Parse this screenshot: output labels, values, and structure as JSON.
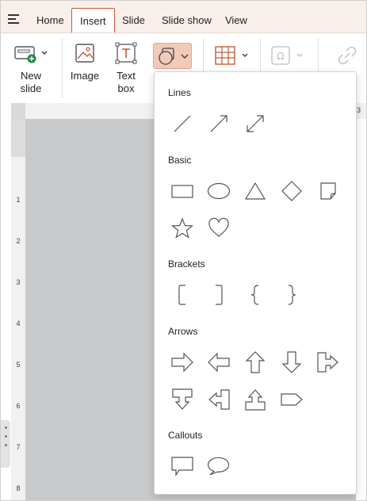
{
  "tabs": [
    {
      "label": "Home",
      "active": false
    },
    {
      "label": "Insert",
      "active": true
    },
    {
      "label": "Slide",
      "active": false
    },
    {
      "label": "Slide show",
      "active": false
    },
    {
      "label": "View",
      "active": false
    }
  ],
  "ribbon": {
    "new_slide_line1": "New",
    "new_slide_line2": "slide",
    "image": "Image",
    "text_box_line1": "Text",
    "text_box_line2": "box"
  },
  "rulers": {
    "vertical": [
      "1",
      "2",
      "3",
      "4",
      "5",
      "6",
      "7",
      "8"
    ],
    "horizontal_visible": "3"
  },
  "shapes_panel": {
    "sections": [
      {
        "title": "Lines",
        "items": [
          "line-icon",
          "arrow-line-icon",
          "double-arrow-line-icon"
        ]
      },
      {
        "title": "Basic",
        "items": [
          "rectangle-icon",
          "ellipse-icon",
          "triangle-icon",
          "diamond-icon",
          "folded-corner-icon",
          "star-icon",
          "heart-icon"
        ]
      },
      {
        "title": "Brackets",
        "items": [
          "left-bracket-icon",
          "right-bracket-icon",
          "left-brace-icon",
          "right-brace-icon"
        ]
      },
      {
        "title": "Arrows",
        "items": [
          "right-arrow-icon",
          "left-arrow-icon",
          "up-arrow-icon",
          "down-arrow-icon",
          "right-arrow-callout-icon",
          "down-arrow-callout-icon",
          "left-arrow-callout-icon",
          "up-arrow-callout-icon",
          "pentagon-arrow-icon"
        ]
      },
      {
        "title": "Callouts",
        "items": [
          "rectangular-callout-icon",
          "oval-callout-icon"
        ]
      }
    ]
  },
  "colors": {
    "tab_bar_bg": "#f8efea",
    "accent": "#c55a3a",
    "selected_button_bg": "#f3c9b9",
    "canvas_bg": "#c8c9cb",
    "new_slide_badge": "#1f8a4c",
    "text_box_icon": "#c55a3a"
  }
}
